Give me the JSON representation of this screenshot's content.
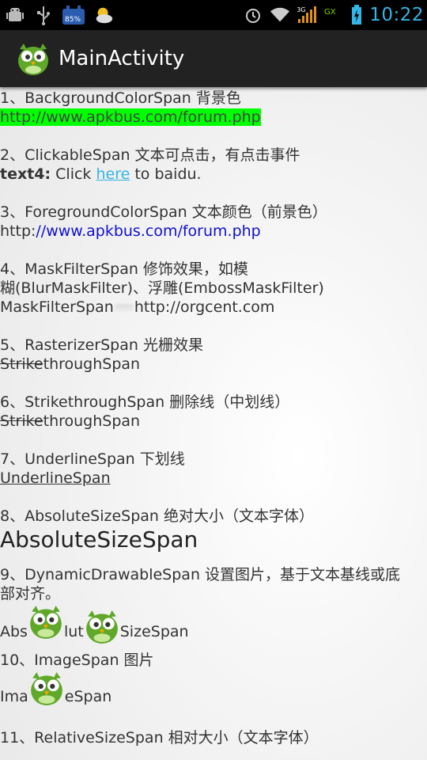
{
  "status_bar": {
    "battery_level": "85%",
    "network_type": "3G",
    "time": "10:22",
    "icons": [
      "android-debug-icon",
      "usb-icon",
      "battery-widget-icon",
      "weather-icon",
      "alarm-icon",
      "wifi-icon",
      "signal-icon",
      "gx-icon",
      "battery-charging-icon"
    ]
  },
  "action_bar": {
    "title": "MainActivity",
    "icon": "owl-logo-icon"
  },
  "sections": {
    "s1": {
      "title": "1、BackgroundColorSpan 背景色",
      "sample": "http://www.apkbus.com/forum.php"
    },
    "s2": {
      "title": "2、ClickableSpan 文本可点击，有点击事件",
      "bold": "text4:",
      "pre": " Click ",
      "link": "here",
      "post": " to baidu."
    },
    "s3": {
      "title": "3、ForegroundColorSpan 文本颜色（前景色）",
      "prefix": "http:",
      "colored": "//www.apkbus.com/forum.php"
    },
    "s4": {
      "title_line1": "4、MaskFilterSpan 修饰效果，如模",
      "title_line2": "糊(BlurMaskFilter)、浮雕(EmbossMaskFilter)",
      "sample_a": "MaskFilterSpan",
      "sample_b": "http://orgcent.com"
    },
    "s5": {
      "title": "5、RasterizerSpan 光栅效果",
      "strike": "Strike",
      "rest": "throughSpan"
    },
    "s6": {
      "title": "6、StrikethroughSpan 删除线（中划线）",
      "strike": "Strike",
      "rest": "throughSpan"
    },
    "s7": {
      "title": "7、UnderlineSpan 下划线",
      "sample": "UnderlineSpan"
    },
    "s8": {
      "title": "8、AbsoluteSizeSpan 绝对大小（文本字体）",
      "sample": "AbsoluteSizeSpan"
    },
    "s9": {
      "title_line1": "9、DynamicDrawableSpan 设置图片，基于文本基线或底",
      "title_line2": "部对齐。",
      "a": "Abs",
      "b": "lut",
      "c": "SizeSpan"
    },
    "s10": {
      "title": "10、ImageSpan 图片",
      "a": "Ima",
      "b": "eSpan"
    },
    "s11": {
      "title": "11、RelativeSizeSpan 相对大小（文本字体）"
    }
  },
  "colors": {
    "background_span": "#00ff00",
    "foreground_span": "#1010d0",
    "link": "#33b5e5",
    "clock": "#33b5e5"
  }
}
